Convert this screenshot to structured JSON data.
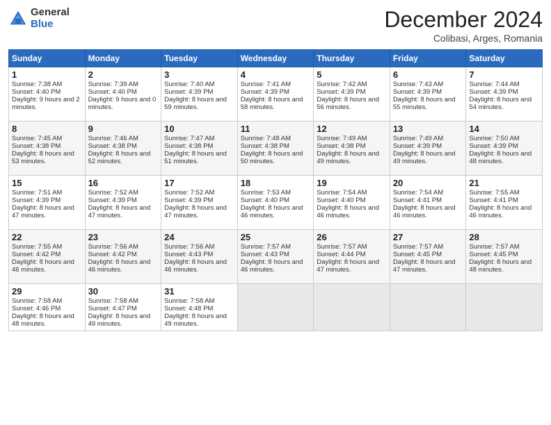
{
  "header": {
    "logo_general": "General",
    "logo_blue": "Blue",
    "month": "December 2024",
    "location": "Colibasi, Arges, Romania"
  },
  "days_of_week": [
    "Sunday",
    "Monday",
    "Tuesday",
    "Wednesday",
    "Thursday",
    "Friday",
    "Saturday"
  ],
  "weeks": [
    [
      {
        "day": "1",
        "sunrise": "Sunrise: 7:38 AM",
        "sunset": "Sunset: 4:40 PM",
        "daylight": "Daylight: 9 hours and 2 minutes."
      },
      {
        "day": "2",
        "sunrise": "Sunrise: 7:39 AM",
        "sunset": "Sunset: 4:40 PM",
        "daylight": "Daylight: 9 hours and 0 minutes."
      },
      {
        "day": "3",
        "sunrise": "Sunrise: 7:40 AM",
        "sunset": "Sunset: 4:39 PM",
        "daylight": "Daylight: 8 hours and 59 minutes."
      },
      {
        "day": "4",
        "sunrise": "Sunrise: 7:41 AM",
        "sunset": "Sunset: 4:39 PM",
        "daylight": "Daylight: 8 hours and 58 minutes."
      },
      {
        "day": "5",
        "sunrise": "Sunrise: 7:42 AM",
        "sunset": "Sunset: 4:39 PM",
        "daylight": "Daylight: 8 hours and 56 minutes."
      },
      {
        "day": "6",
        "sunrise": "Sunrise: 7:43 AM",
        "sunset": "Sunset: 4:39 PM",
        "daylight": "Daylight: 8 hours and 55 minutes."
      },
      {
        "day": "7",
        "sunrise": "Sunrise: 7:44 AM",
        "sunset": "Sunset: 4:39 PM",
        "daylight": "Daylight: 8 hours and 54 minutes."
      }
    ],
    [
      {
        "day": "8",
        "sunrise": "Sunrise: 7:45 AM",
        "sunset": "Sunset: 4:38 PM",
        "daylight": "Daylight: 8 hours and 53 minutes."
      },
      {
        "day": "9",
        "sunrise": "Sunrise: 7:46 AM",
        "sunset": "Sunset: 4:38 PM",
        "daylight": "Daylight: 8 hours and 52 minutes."
      },
      {
        "day": "10",
        "sunrise": "Sunrise: 7:47 AM",
        "sunset": "Sunset: 4:38 PM",
        "daylight": "Daylight: 8 hours and 51 minutes."
      },
      {
        "day": "11",
        "sunrise": "Sunrise: 7:48 AM",
        "sunset": "Sunset: 4:38 PM",
        "daylight": "Daylight: 8 hours and 50 minutes."
      },
      {
        "day": "12",
        "sunrise": "Sunrise: 7:49 AM",
        "sunset": "Sunset: 4:38 PM",
        "daylight": "Daylight: 8 hours and 49 minutes."
      },
      {
        "day": "13",
        "sunrise": "Sunrise: 7:49 AM",
        "sunset": "Sunset: 4:39 PM",
        "daylight": "Daylight: 8 hours and 49 minutes."
      },
      {
        "day": "14",
        "sunrise": "Sunrise: 7:50 AM",
        "sunset": "Sunset: 4:39 PM",
        "daylight": "Daylight: 8 hours and 48 minutes."
      }
    ],
    [
      {
        "day": "15",
        "sunrise": "Sunrise: 7:51 AM",
        "sunset": "Sunset: 4:39 PM",
        "daylight": "Daylight: 8 hours and 47 minutes."
      },
      {
        "day": "16",
        "sunrise": "Sunrise: 7:52 AM",
        "sunset": "Sunset: 4:39 PM",
        "daylight": "Daylight: 8 hours and 47 minutes."
      },
      {
        "day": "17",
        "sunrise": "Sunrise: 7:52 AM",
        "sunset": "Sunset: 4:39 PM",
        "daylight": "Daylight: 8 hours and 47 minutes."
      },
      {
        "day": "18",
        "sunrise": "Sunrise: 7:53 AM",
        "sunset": "Sunset: 4:40 PM",
        "daylight": "Daylight: 8 hours and 46 minutes."
      },
      {
        "day": "19",
        "sunrise": "Sunrise: 7:54 AM",
        "sunset": "Sunset: 4:40 PM",
        "daylight": "Daylight: 8 hours and 46 minutes."
      },
      {
        "day": "20",
        "sunrise": "Sunrise: 7:54 AM",
        "sunset": "Sunset: 4:41 PM",
        "daylight": "Daylight: 8 hours and 46 minutes."
      },
      {
        "day": "21",
        "sunrise": "Sunrise: 7:55 AM",
        "sunset": "Sunset: 4:41 PM",
        "daylight": "Daylight: 8 hours and 46 minutes."
      }
    ],
    [
      {
        "day": "22",
        "sunrise": "Sunrise: 7:55 AM",
        "sunset": "Sunset: 4:42 PM",
        "daylight": "Daylight: 8 hours and 46 minutes."
      },
      {
        "day": "23",
        "sunrise": "Sunrise: 7:56 AM",
        "sunset": "Sunset: 4:42 PM",
        "daylight": "Daylight: 8 hours and 46 minutes."
      },
      {
        "day": "24",
        "sunrise": "Sunrise: 7:56 AM",
        "sunset": "Sunset: 4:43 PM",
        "daylight": "Daylight: 8 hours and 46 minutes."
      },
      {
        "day": "25",
        "sunrise": "Sunrise: 7:57 AM",
        "sunset": "Sunset: 4:43 PM",
        "daylight": "Daylight: 8 hours and 46 minutes."
      },
      {
        "day": "26",
        "sunrise": "Sunrise: 7:57 AM",
        "sunset": "Sunset: 4:44 PM",
        "daylight": "Daylight: 8 hours and 47 minutes."
      },
      {
        "day": "27",
        "sunrise": "Sunrise: 7:57 AM",
        "sunset": "Sunset: 4:45 PM",
        "daylight": "Daylight: 8 hours and 47 minutes."
      },
      {
        "day": "28",
        "sunrise": "Sunrise: 7:57 AM",
        "sunset": "Sunset: 4:45 PM",
        "daylight": "Daylight: 8 hours and 48 minutes."
      }
    ],
    [
      {
        "day": "29",
        "sunrise": "Sunrise: 7:58 AM",
        "sunset": "Sunset: 4:46 PM",
        "daylight": "Daylight: 8 hours and 48 minutes."
      },
      {
        "day": "30",
        "sunrise": "Sunrise: 7:58 AM",
        "sunset": "Sunset: 4:47 PM",
        "daylight": "Daylight: 8 hours and 49 minutes."
      },
      {
        "day": "31",
        "sunrise": "Sunrise: 7:58 AM",
        "sunset": "Sunset: 4:48 PM",
        "daylight": "Daylight: 8 hours and 49 minutes."
      },
      null,
      null,
      null,
      null
    ]
  ]
}
